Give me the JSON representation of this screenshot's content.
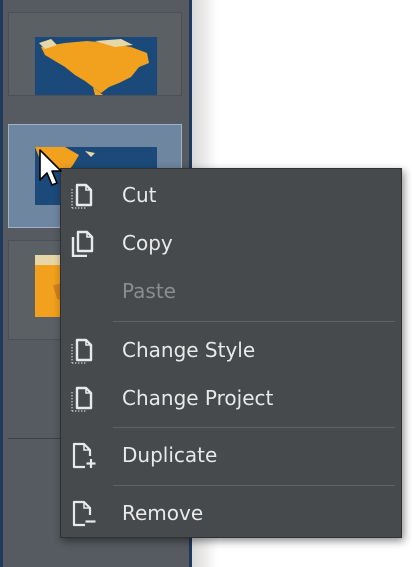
{
  "menu": {
    "items": [
      {
        "label": "Cut",
        "icon": "cut-icon",
        "enabled": true
      },
      {
        "label": "Copy",
        "icon": "copy-icon",
        "enabled": true
      },
      {
        "label": "Paste",
        "icon": "paste-icon",
        "enabled": false
      },
      {
        "label": "Change Style",
        "icon": "change-style-icon",
        "enabled": true
      },
      {
        "label": "Change Project",
        "icon": "change-project-icon",
        "enabled": true
      },
      {
        "label": "Duplicate",
        "icon": "duplicate-icon",
        "enabled": true
      },
      {
        "label": "Remove",
        "icon": "remove-icon",
        "enabled": true
      }
    ]
  },
  "slides": {
    "selected_index": 1,
    "thumbnails": [
      "north-america-map",
      "north-america-map",
      "map-thumbnail"
    ]
  },
  "colors": {
    "menu_background": "#464a4d",
    "menu_text": "#e9e9e9",
    "disabled_text": "#8a8d90",
    "panel_background": "#555b60",
    "selected_slot": "#6f86a0",
    "map_ocean": "#1b4a7a",
    "map_land": "#f1a11e"
  }
}
